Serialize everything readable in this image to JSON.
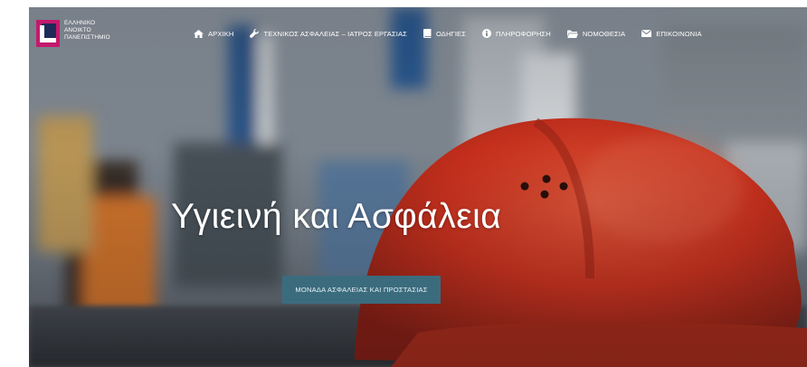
{
  "logo": {
    "lines": [
      "ΕΛΛΗΝΙΚΟ",
      "ΑΝΟΙΚΤΟ",
      "ΠΑΝΕΠΙΣΤΗΜΙΟ"
    ],
    "colors": {
      "magenta": "#c3196c",
      "navy": "#1e2a5a",
      "white": "#ffffff"
    }
  },
  "nav": {
    "items": [
      {
        "label": "ΑΡΧΙΚΗ",
        "icon": "home-icon"
      },
      {
        "label": "ΤΕΧΝΙΚΟΣ ΑΣΦΑΛΕΙΑΣ – ΙΑΤΡΟΣ ΕΡΓΑΣΙΑΣ",
        "icon": "wrench-icon"
      },
      {
        "label": "ΟΔΗΓΙΕΣ",
        "icon": "book-icon"
      },
      {
        "label": "ΠΛΗΡΟΦΟΡΗΣΗ",
        "icon": "info-icon"
      },
      {
        "label": "ΝΟΜΟΘΕΣΙΑ",
        "icon": "folder-open-icon"
      },
      {
        "label": "ΕΠΙΚΟΙΝΩΝΙΑ",
        "icon": "envelope-icon"
      }
    ]
  },
  "hero": {
    "title": "Υγιεινή και Ασφάλεια",
    "button_label": "ΜΟΝΑΔΑ ΑΣΦΑΛΕΙΑΣ ΚΑΙ ΠΡΟΣΤΑΣΙΑΣ",
    "background": "red-hard-hat-photo"
  },
  "colors": {
    "button": "#3b6c7e",
    "helmet": "#e2371f",
    "text": "#ffffff"
  }
}
